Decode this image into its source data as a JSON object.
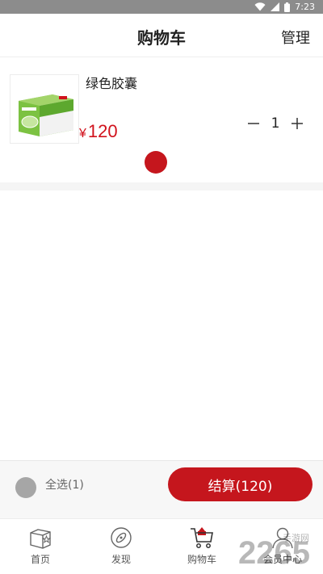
{
  "status_bar": {
    "time": "7:23"
  },
  "header": {
    "title": "购物车",
    "manage_label": "管理"
  },
  "cart": {
    "items": [
      {
        "name": "绿色胶囊",
        "currency": "¥",
        "price": "120",
        "quantity": "1",
        "selected": true
      }
    ]
  },
  "footer": {
    "select_all_label": "全选(1)",
    "checkout_label": "结算(120)"
  },
  "tabs": [
    {
      "label": "首页",
      "icon": "home-box-star-icon"
    },
    {
      "label": "发现",
      "icon": "compass-icon"
    },
    {
      "label": "购物车",
      "icon": "cart-icon"
    },
    {
      "label": "会员中心",
      "icon": "user-icon"
    }
  ],
  "colors": {
    "accent": "#c5161d",
    "price": "#d1121c",
    "status_bar": "#8c8c8c"
  },
  "watermark": {
    "text": "2265",
    "subtext": "手游网"
  }
}
